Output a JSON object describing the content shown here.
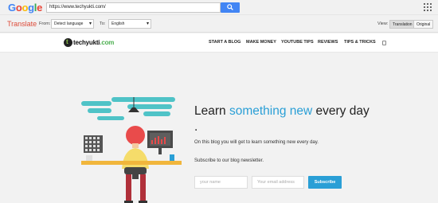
{
  "google_bar": {
    "logo_letters": [
      "G",
      "o",
      "o",
      "g",
      "l",
      "e"
    ],
    "url_value": "https://www.techyukti.com/",
    "search_icon": "search-icon",
    "apps_icon": "apps-grid-icon"
  },
  "translate_bar": {
    "title": "Translate",
    "from_label": "From:",
    "from_value": "Detect language",
    "to_label": "To:",
    "to_value": "English",
    "view_label": "View:",
    "view_translation": "Translation",
    "view_original": "Original"
  },
  "site": {
    "logo_text_main": "techyukti",
    "logo_text_domain": ".com",
    "nav": [
      "START A BLOG",
      "MAKE MONEY",
      "YOUTUBE TIPS",
      "REVIEWS",
      "TIPS & TRICKS"
    ],
    "nav_search_icon": "search-icon"
  },
  "hero": {
    "headline_pre": "Learn ",
    "headline_accent": "something new",
    "headline_post": " every day .",
    "subline": "On this blog you will get to learn something new every day.",
    "subscribe_text": "Subscribe to our blog newsletter.",
    "name_placeholder": "your name",
    "email_placeholder": "Your email address",
    "subscribe_button": "Subscribe"
  },
  "colors": {
    "accent": "#2a9fd6",
    "google_blue": "#4285f4",
    "translate_red": "#dd4b39",
    "logo_green": "#4caf50"
  }
}
